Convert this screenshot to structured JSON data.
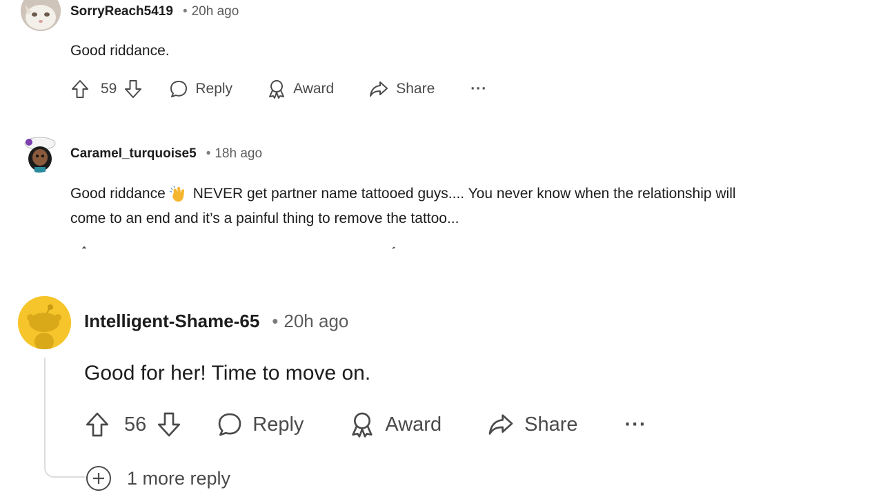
{
  "comments_top": [
    {
      "username": "SorryReach5419",
      "time": "20h ago",
      "text": "Good riddance.",
      "votes": "59",
      "reply_label": "Reply",
      "award_label": "Award",
      "share_label": "Share",
      "more_label": "···"
    },
    {
      "username": "Caramel_turquoise5",
      "time": "18h ago",
      "text_line1_a": "Good riddance",
      "text_line1_b": "NEVER get partner name tattooed guys.... You never know when the relationship will",
      "text_line2": "come to an end and it’s a painful thing to remove the tattoo..."
    }
  ],
  "comment_bottom": {
    "username": "Intelligent-Shame-65",
    "time": "20h ago",
    "text": "Good for her! Time to move on.",
    "votes": "56",
    "reply_label": "Reply",
    "award_label": "Award",
    "share_label": "Share",
    "more_label": "···",
    "more_replies": "1 more reply"
  },
  "icons": [
    "upvote-icon",
    "downvote-icon",
    "comment-bubble-icon",
    "award-icon",
    "share-icon",
    "more-options-icon",
    "clap-emoji-icon",
    "expand-plus-icon"
  ],
  "colors": {
    "snoo_avatar_bg": "#f5c52b",
    "text": "#1c1c1c",
    "muted": "#5c5c5c"
  }
}
